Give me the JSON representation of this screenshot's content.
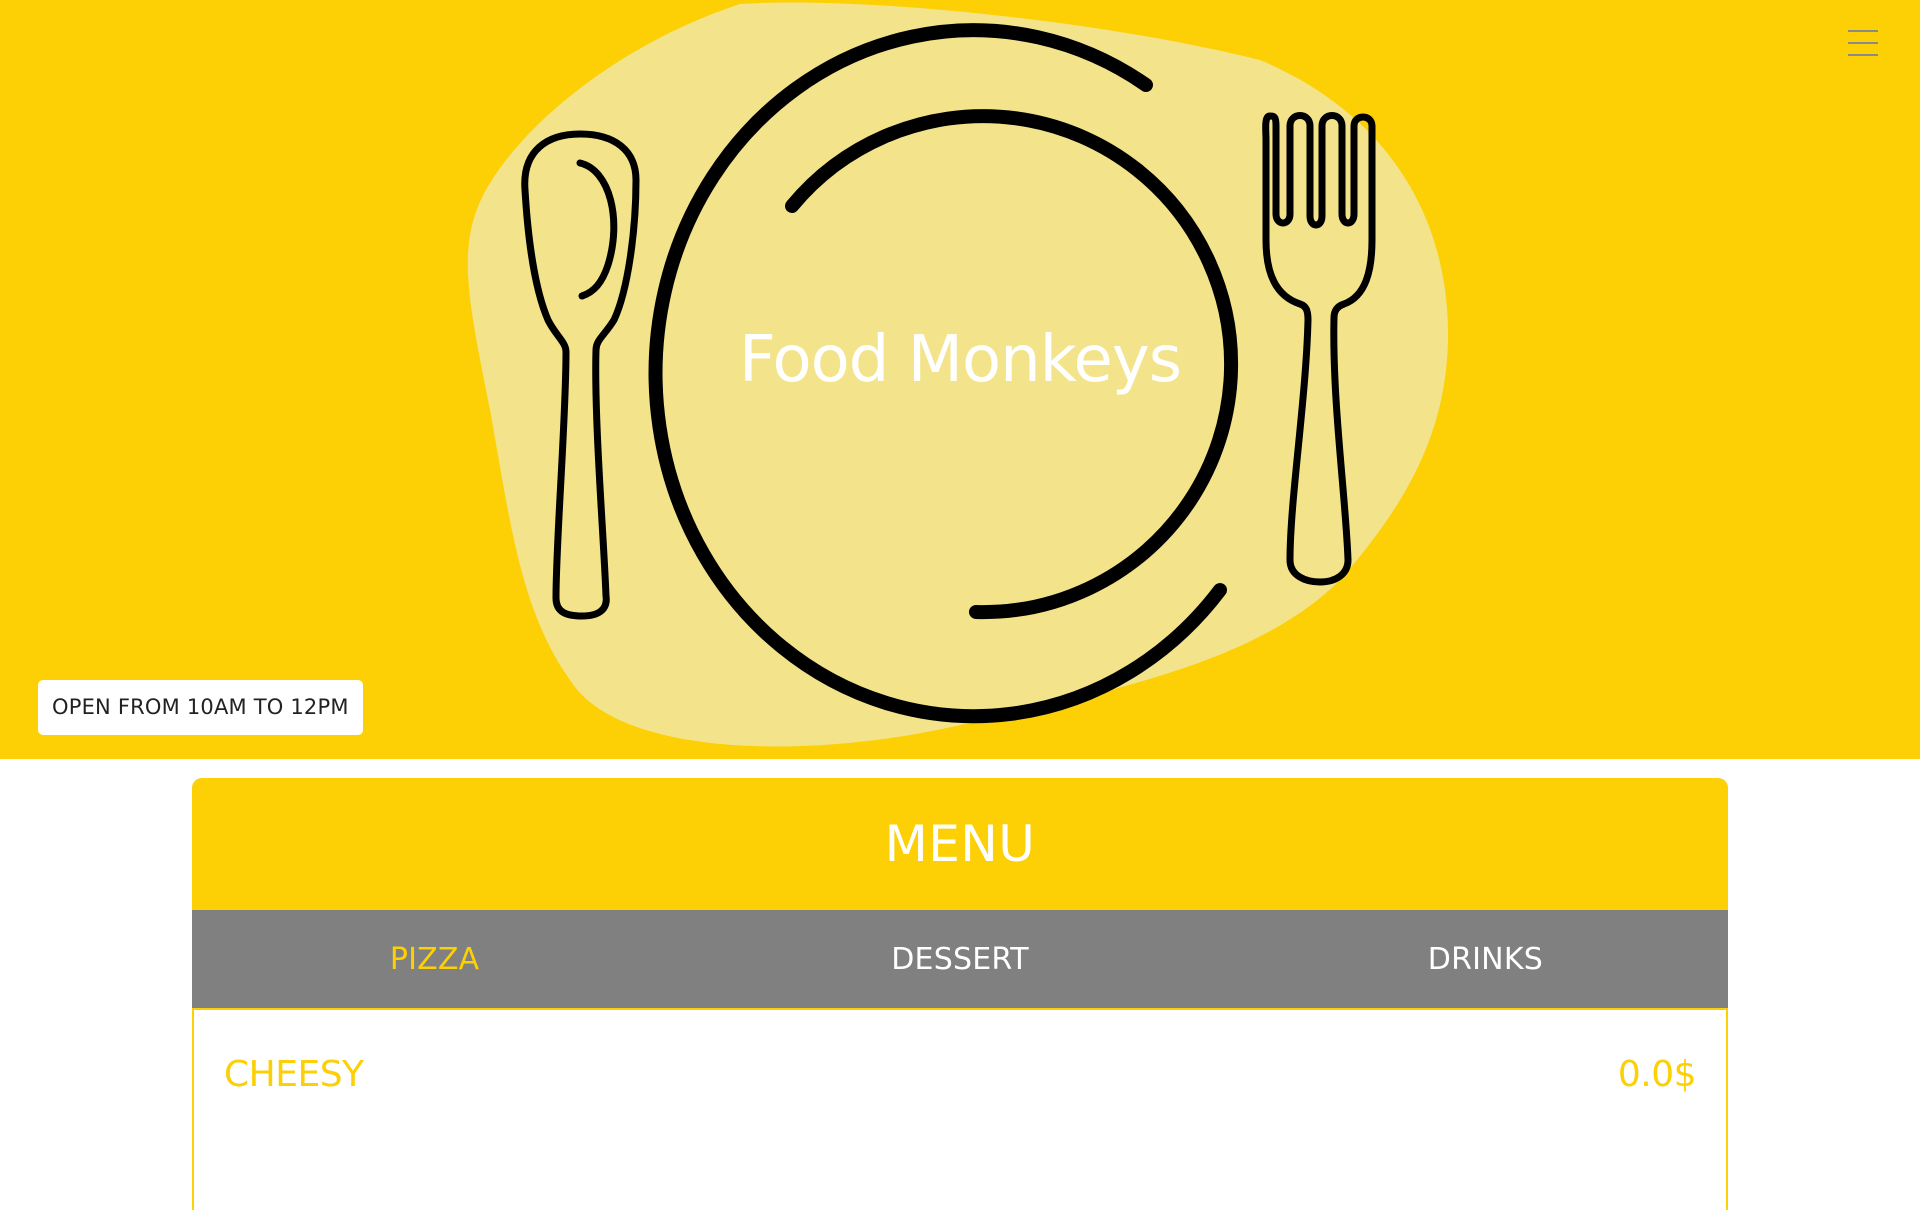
{
  "hero": {
    "title": "Food Monkeys",
    "hours": "OPEN FROM 10AM TO 12PM",
    "menu_toggle_icon": "hamburger-icon",
    "background_color": "#fcd004",
    "blob_color": "#f3e38a"
  },
  "menu": {
    "heading": "MENU",
    "tabs": [
      {
        "label": "PIZZA",
        "active": true
      },
      {
        "label": "DESSERT",
        "active": false
      },
      {
        "label": "DRINKS",
        "active": false
      }
    ],
    "items": [
      {
        "name": "CHEESY",
        "price": "0.0$"
      }
    ],
    "accent_color": "#fcd004",
    "tab_bar_color": "#808080"
  }
}
